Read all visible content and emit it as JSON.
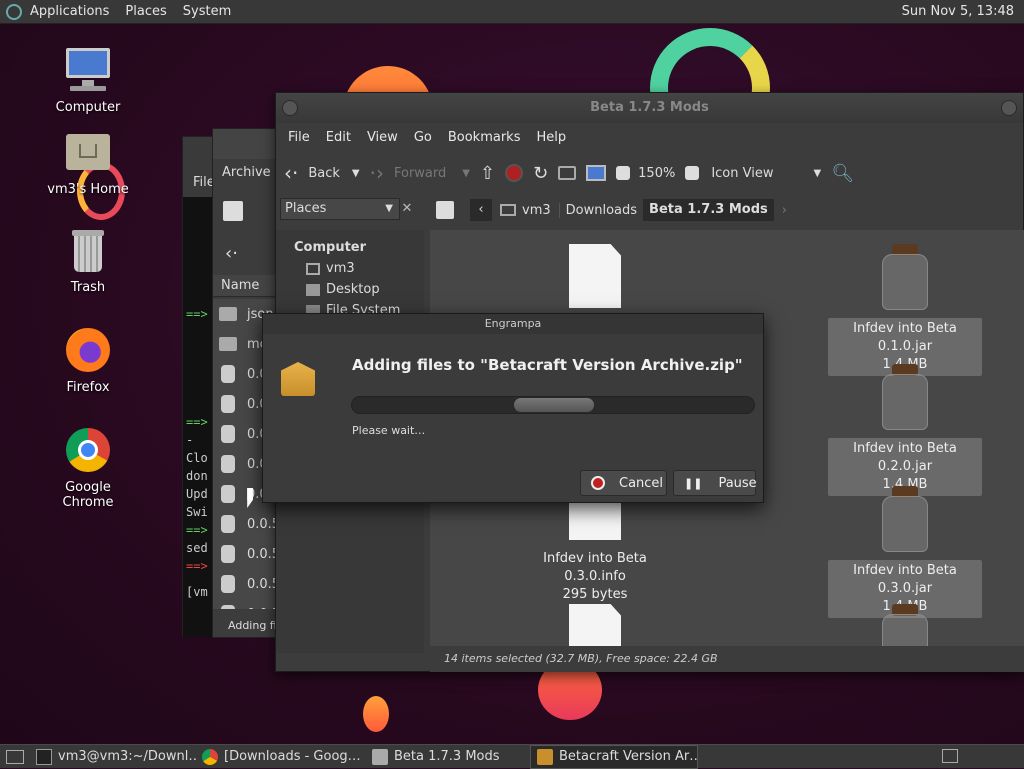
{
  "top_panel": {
    "menus": [
      "Applications",
      "Places",
      "System"
    ],
    "clock": "Sun Nov 5, 13:48"
  },
  "desktop_icons": [
    {
      "label": "Computer",
      "icon": "computer-icon"
    },
    {
      "label": "vm3's Home",
      "icon": "home-folder-icon"
    },
    {
      "label": "Trash",
      "icon": "trash-icon"
    },
    {
      "label": "Firefox",
      "icon": "firefox-icon"
    },
    {
      "label": "Google Chrome",
      "icon": "chrome-icon"
    }
  ],
  "terminal": {
    "title_partial": "File",
    "lines": [
      "==>",
      "==>",
      "  -",
      "Clo",
      "don",
      "Upd",
      "Swi",
      "==>",
      "sed",
      "==>",
      "[vm"
    ]
  },
  "archive_window": {
    "title_partial": "Archive",
    "column_header": "Name",
    "items": [
      "json",
      "mc",
      "0.0",
      "0.0",
      "0.0",
      "0.0",
      "0.0",
      "0.0.5",
      "0.0.5",
      "0.0.5",
      "0.0.5"
    ],
    "status_partial": "Adding fil"
  },
  "file_manager": {
    "title": "Beta 1.7.3 Mods",
    "menu": [
      "File",
      "Edit",
      "View",
      "Go",
      "Bookmarks",
      "Help"
    ],
    "toolbar": {
      "back": "Back",
      "forward": "Forward",
      "zoom": "150%",
      "view_mode": "Icon View"
    },
    "places_label": "Places",
    "breadcrumb": [
      "vm3",
      "Downloads",
      "Beta 1.7.3 Mods"
    ],
    "sidebar": {
      "section": "Computer",
      "items": [
        "vm3",
        "Desktop",
        "File System"
      ]
    },
    "files": [
      {
        "name": "Infdev into Beta 0.1.0.jar",
        "size": "1.4 MB",
        "type": "jar",
        "selected": true
      },
      {
        "name": "Infdev into Beta 0.2.0.jar",
        "size": "1.4 MB",
        "type": "jar",
        "selected": true
      },
      {
        "name": "Infdev into Beta 0.3.0.info",
        "size": "295 bytes",
        "type": "doc",
        "selected": false
      },
      {
        "name": "Infdev into Beta 0.3.0.jar",
        "size": "1.4 MB",
        "type": "jar",
        "selected": true
      }
    ],
    "status": "14 items selected (32.7 MB), Free space: 22.4 GB"
  },
  "dialog": {
    "title": "Engrampa",
    "heading": "Adding files to \"Betacraft Version Archive.zip\"",
    "message": "Please wait…",
    "cancel": "Cancel",
    "pause": "Pause",
    "progress": 0.5
  },
  "taskbar": [
    {
      "label": "vm3@vm3:~/Downl…",
      "icon": "terminal-icon",
      "active": false
    },
    {
      "label": "[Downloads - Goog…",
      "icon": "chrome-icon",
      "active": false
    },
    {
      "label": "Beta 1.7.3 Mods",
      "icon": "folder-icon",
      "active": false
    },
    {
      "label": "Betacraft Version Ar…",
      "icon": "archive-icon",
      "active": true
    }
  ]
}
